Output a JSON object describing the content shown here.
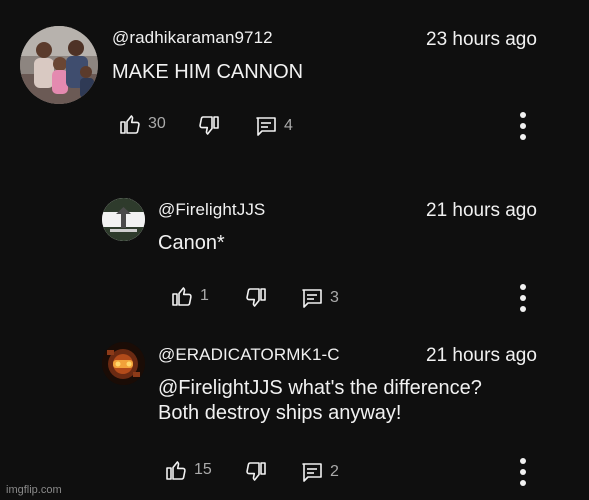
{
  "comments": [
    {
      "handle": "@radhikaraman9712",
      "time": "23 hours ago",
      "text": "MAKE HIM CANNON",
      "likes": "30",
      "replies": "4"
    },
    {
      "handle": "@FirelightJJS",
      "time": "21 hours ago",
      "text": "Canon*",
      "likes": "1",
      "replies": "3"
    },
    {
      "handle": "@ERADICATORMK1-C",
      "time": "21 hours ago",
      "text": "@FirelightJJS what's the difference?\nBoth destroy ships anyway!",
      "likes": "15",
      "replies": "2"
    }
  ],
  "watermark": "imgflip.com",
  "icons": {
    "like": "thumbs-up-icon",
    "dislike": "thumbs-down-icon",
    "reply": "comment-icon",
    "more": "more-vert-icon"
  },
  "colors": {
    "background": "#0f0f0f",
    "text": "#f1f1f1",
    "secondary": "#aaaaaa"
  }
}
